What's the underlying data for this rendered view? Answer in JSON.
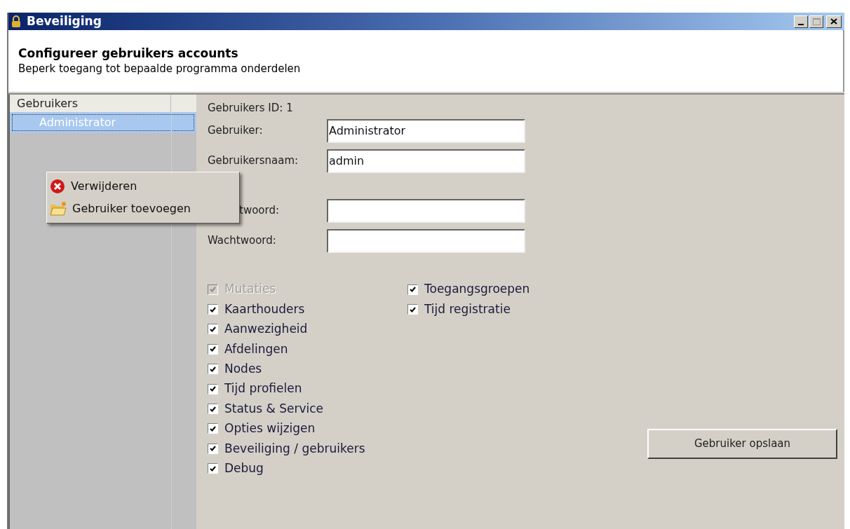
{
  "window": {
    "title": "Beveiliging"
  },
  "header": {
    "title": "Configureer gebruikers accounts",
    "subtitle": "Beperk toegang tot bepaalde programma onderdelen"
  },
  "tree": {
    "column": "Gebruikers",
    "items": [
      {
        "label": "Administrator",
        "selected": true
      }
    ]
  },
  "context_menu": [
    {
      "kind": "delete",
      "label": "Verwijderen"
    },
    {
      "kind": "add",
      "label": "Gebruiker toevoegen"
    }
  ],
  "form": {
    "id_label": "Gebruikers ID: 1",
    "account_fields": [
      {
        "label": "Gebruiker:",
        "value": "Administrator"
      },
      {
        "label": "Gebruikersnaam:",
        "value": "admin"
      }
    ],
    "password_fields": [
      {
        "label": "twoord:"
      },
      {
        "label": "Wachtwoord:"
      }
    ]
  },
  "permissions": {
    "columns": [
      [
        {
          "label": "Mutaties",
          "checked": true,
          "disabled": true
        },
        {
          "label": "Kaarthouders",
          "checked": true,
          "disabled": false
        },
        {
          "label": "Aanwezigheid",
          "checked": true,
          "disabled": false
        },
        {
          "label": "Afdelingen",
          "checked": true,
          "disabled": false
        },
        {
          "label": "Nodes",
          "checked": true,
          "disabled": false
        },
        {
          "label": "Tijd profielen",
          "checked": true,
          "disabled": false
        },
        {
          "label": "Status & Service",
          "checked": true,
          "disabled": false
        },
        {
          "label": "Opties wijzigen",
          "checked": true,
          "disabled": false
        },
        {
          "label": "Beveiliging / gebruikers",
          "checked": true,
          "disabled": false
        },
        {
          "label": "Debug",
          "checked": true,
          "disabled": false
        }
      ],
      [
        {
          "label": "Toegangsgroepen",
          "checked": true,
          "disabled": false
        },
        {
          "label": "Tijd registratie",
          "checked": true,
          "disabled": false
        }
      ]
    ]
  },
  "save_button": "Gebruiker opslaan"
}
